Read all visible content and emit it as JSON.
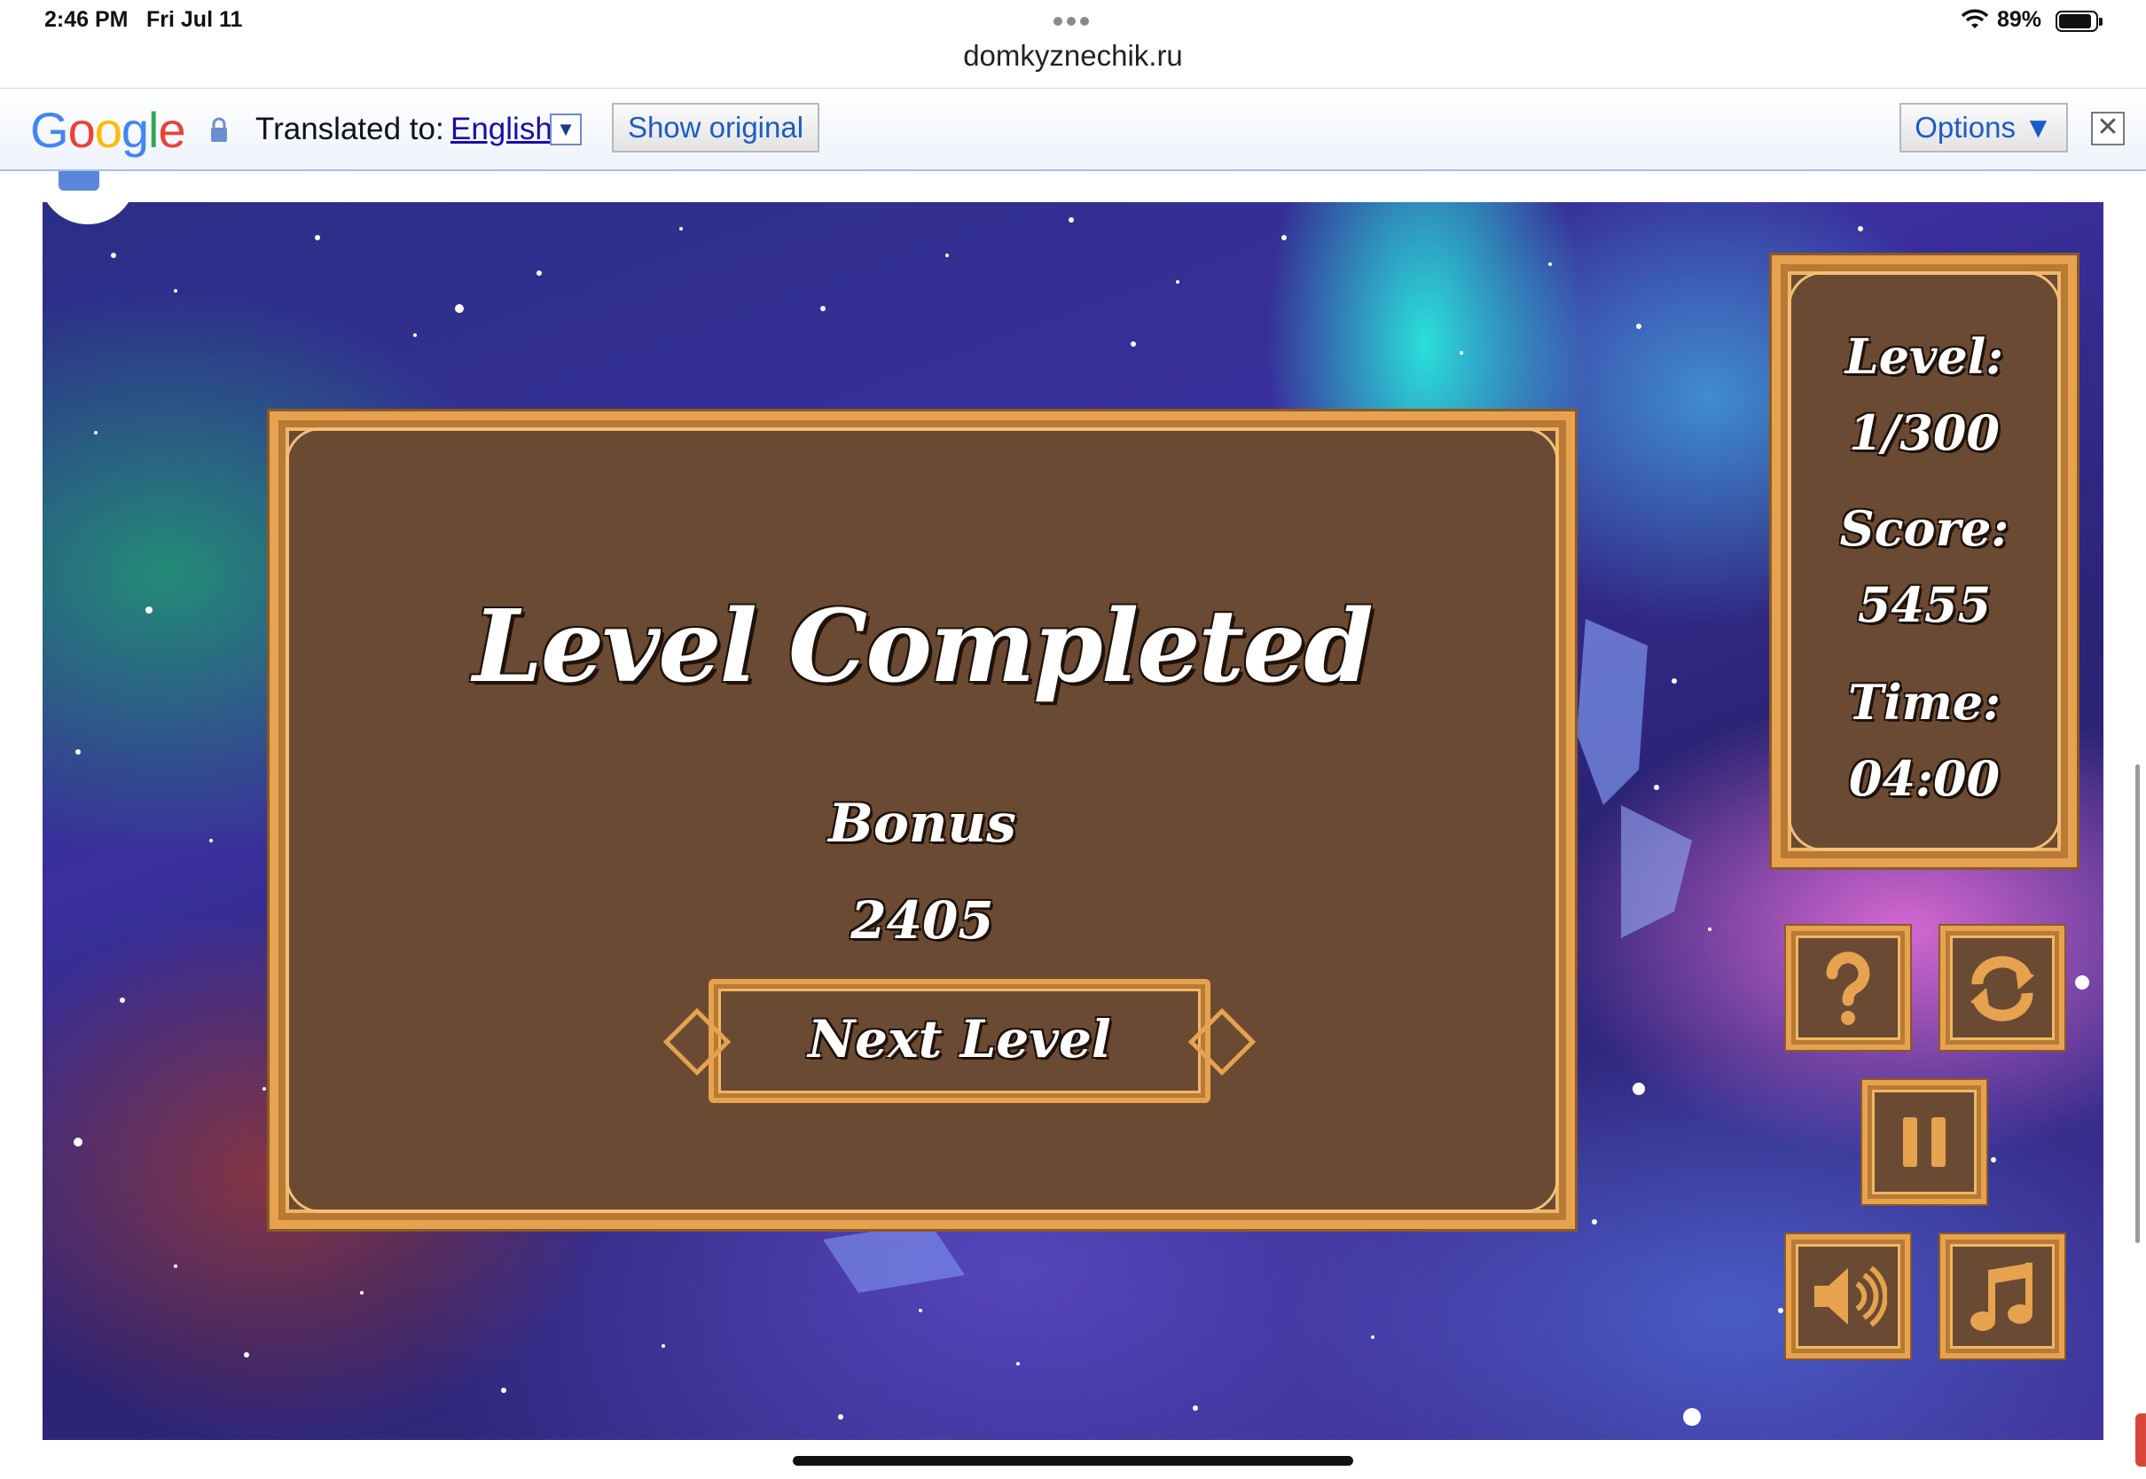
{
  "status_bar": {
    "time": "2:46 PM",
    "date": "Fri Jul 11",
    "battery_percent": "89%",
    "battery_level": 0.89
  },
  "browser": {
    "url": "domkyznechik.ru"
  },
  "translate_bar": {
    "logo": "Google",
    "translated_to_label": "Translated to:",
    "language": "English",
    "show_original": "Show original",
    "options": "Options ▼",
    "close_glyph": "✕"
  },
  "dialog": {
    "title": "Level Completed",
    "bonus_label": "Bonus",
    "bonus_value": "2405",
    "next_button": "Next Level"
  },
  "stats": {
    "level_label": "Level:",
    "level_value": "1/300",
    "score_label": "Score:",
    "score_value": "5455",
    "time_label": "Time:",
    "time_value": "04:00"
  },
  "controls": {
    "help": "question-icon",
    "restart": "refresh-icon",
    "pause": "pause-icon",
    "sound": "speaker-icon",
    "music": "music-note-icon"
  },
  "colors": {
    "panel_bg": "#6a4a33",
    "frame_gold": "#e6a24f",
    "aurora": "#28ffe6",
    "link_blue": "#1a0dab"
  }
}
